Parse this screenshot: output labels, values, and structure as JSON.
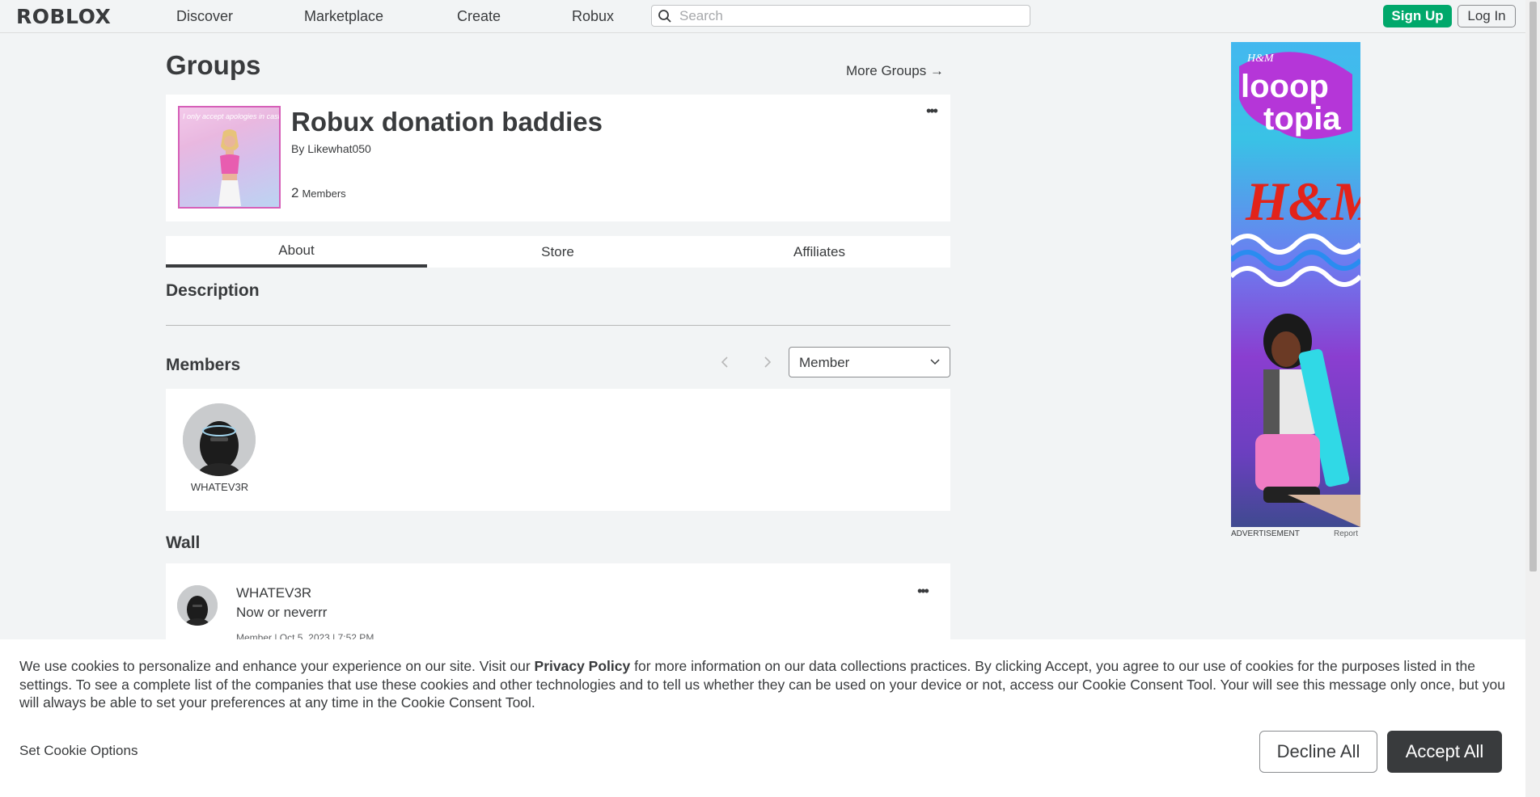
{
  "nav": {
    "logo": "ROBLOX",
    "links": [
      "Discover",
      "Marketplace",
      "Create",
      "Robux"
    ],
    "search_placeholder": "Search",
    "signup": "Sign Up",
    "login": "Log In"
  },
  "page": {
    "title": "Groups",
    "more_groups": "More Groups →"
  },
  "group": {
    "name": "Robux donation baddies",
    "by_prefix": "By",
    "owner": "Likewhat050",
    "member_count": "2",
    "member_label": "Members",
    "thumbnail_caption": "I only accept apologies in cash"
  },
  "tabs": [
    "About",
    "Store",
    "Affiliates"
  ],
  "description": {
    "heading": "Description"
  },
  "members": {
    "heading": "Members",
    "role_filter": "Member",
    "list": [
      {
        "name": "WHATEV3R"
      }
    ]
  },
  "wall": {
    "heading": "Wall",
    "posts": [
      {
        "author": "WHATEV3R",
        "body": "Now or neverrr",
        "meta": "Member | Oct 5, 2023 | 7:52 PM"
      }
    ]
  },
  "ad": {
    "label": "ADVERTISEMENT",
    "report": "Report",
    "brand_small": "H&M",
    "headline_1": "looop",
    "headline_2": "topia",
    "brand_large": "H&M"
  },
  "cookie": {
    "text_before": "We use cookies to personalize and enhance your experience on our site. Visit our ",
    "link": "Privacy Policy",
    "text_after": " for more information on our data collections practices. By clicking Accept, you agree to our use of cookies for the purposes listed in the settings. To see a complete list of the companies that use these cookies and other technologies and to tell us whether they can be used on your device or not, access our Cookie Consent Tool. Your will see this message only once, but you will always be able to set your preferences at any time in the Cookie Consent Tool.",
    "options": "Set Cookie Options",
    "decline": "Decline All",
    "accept": "Accept All"
  },
  "colors": {
    "signup_green": "#00a86b",
    "text_dark": "#393b3d",
    "background": "#f2f4f5"
  }
}
